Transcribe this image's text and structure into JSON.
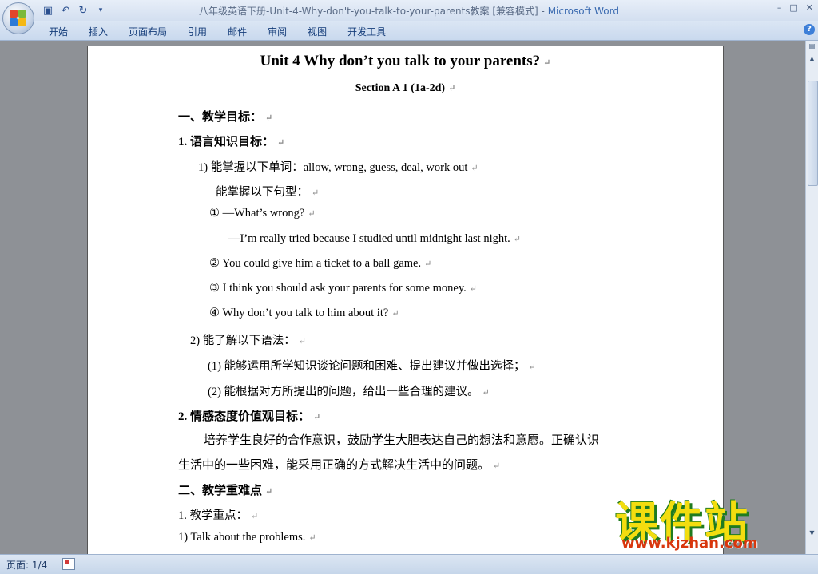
{
  "window": {
    "title_doc": "八年级英语下册-Unit-4-Why-don't-you-talk-to-your-parents教案 [兼容模式] - ",
    "title_app": "Microsoft Word"
  },
  "qat": {
    "save_icon": "save-icon",
    "undo_icon": "undo-icon",
    "redo_icon": "redo-icon",
    "customize_icon": "customize-icon"
  },
  "window_controls": {
    "minimize": "–",
    "maximize": "□",
    "close": "✕"
  },
  "ribbon": {
    "tabs": [
      "开始",
      "插入",
      "页面布局",
      "引用",
      "邮件",
      "审阅",
      "视图",
      "开发工具"
    ],
    "help": "?"
  },
  "document": {
    "title": "Unit 4 Why don’t you talk to your parents?",
    "subtitle": "Section A 1 (1a-2d)",
    "lines": [
      "一、教学目标：",
      "1. 语言知识目标：",
      "1) 能掌握以下单词：allow, wrong, guess, deal, work out",
      "能掌握以下句型：",
      "① —What’s wrong?",
      "—I’m really tried because I studied until midnight last night.",
      "② You could give him a ticket to a ball game.",
      "③ I think you should ask your parents for some money.",
      "④ Why don’t you talk to him about it?",
      "2) 能了解以下语法：",
      "(1) 能够运用所学知识谈论问题和困难、提出建议并做出选择；",
      "(2) 能根据对方所提出的问题，给出一些合理的建议。",
      "2. 情感态度价值观目标：",
      "培养学生良好的合作意识，鼓励学生大胆表达自己的想法和意愿。正确认识",
      "生活中的一些困难，能采用正确的方式解决生活中的问题。",
      "二、教学重难点",
      "1. 教学重点：",
      "1) Talk about the problems."
    ],
    "para_mark": "↵"
  },
  "status": {
    "page": "页面: 1/4"
  },
  "watermark": {
    "cn": "课件站",
    "en": "www.kjzhan.com"
  }
}
